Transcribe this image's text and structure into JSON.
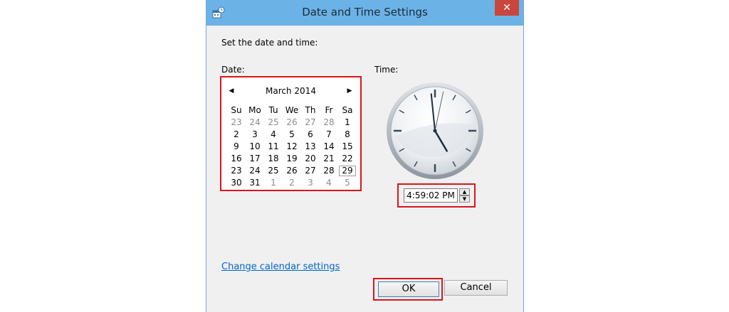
{
  "window": {
    "title": "Date and Time Settings",
    "close_glyph": "✕",
    "accent_color": "#6bb3e6",
    "close_color": "#c9463d",
    "app_icon": "date-time-settings-icon"
  },
  "main": {
    "instruction": "Set the date and time:",
    "date_label": "Date:",
    "time_label": "Time:"
  },
  "calendar": {
    "month_label": "March 2014",
    "prev_glyph": "◀",
    "next_glyph": "▶",
    "days_of_week": [
      "Su",
      "Mo",
      "Tu",
      "We",
      "Th",
      "Fr",
      "Sa"
    ],
    "weeks": [
      [
        {
          "d": "23",
          "o": true
        },
        {
          "d": "24",
          "o": true
        },
        {
          "d": "25",
          "o": true
        },
        {
          "d": "26",
          "o": true
        },
        {
          "d": "27",
          "o": true
        },
        {
          "d": "28",
          "o": true
        },
        {
          "d": "1",
          "o": false
        }
      ],
      [
        {
          "d": "2",
          "o": false
        },
        {
          "d": "3",
          "o": false
        },
        {
          "d": "4",
          "o": false
        },
        {
          "d": "5",
          "o": false
        },
        {
          "d": "6",
          "o": false
        },
        {
          "d": "7",
          "o": false
        },
        {
          "d": "8",
          "o": false
        }
      ],
      [
        {
          "d": "9",
          "o": false
        },
        {
          "d": "10",
          "o": false
        },
        {
          "d": "11",
          "o": false
        },
        {
          "d": "12",
          "o": false
        },
        {
          "d": "13",
          "o": false
        },
        {
          "d": "14",
          "o": false
        },
        {
          "d": "15",
          "o": false
        }
      ],
      [
        {
          "d": "16",
          "o": false
        },
        {
          "d": "17",
          "o": false
        },
        {
          "d": "18",
          "o": false
        },
        {
          "d": "19",
          "o": false
        },
        {
          "d": "20",
          "o": false
        },
        {
          "d": "21",
          "o": false
        },
        {
          "d": "22",
          "o": false
        }
      ],
      [
        {
          "d": "23",
          "o": false
        },
        {
          "d": "24",
          "o": false
        },
        {
          "d": "25",
          "o": false
        },
        {
          "d": "26",
          "o": false
        },
        {
          "d": "27",
          "o": false
        },
        {
          "d": "28",
          "o": false
        },
        {
          "d": "29",
          "o": false,
          "today": true
        }
      ],
      [
        {
          "d": "30",
          "o": false
        },
        {
          "d": "31",
          "o": false
        },
        {
          "d": "1",
          "o": true
        },
        {
          "d": "2",
          "o": true
        },
        {
          "d": "3",
          "o": true
        },
        {
          "d": "4",
          "o": true
        },
        {
          "d": "5",
          "o": true
        }
      ]
    ]
  },
  "clock": {
    "hour": 4,
    "minute": 59,
    "second": 2
  },
  "time_field": {
    "value": "4:59:02 PM",
    "spin_up_glyph": "▲",
    "spin_down_glyph": "▼"
  },
  "footer": {
    "link_label": "Change calendar settings",
    "ok_label": "OK",
    "cancel_label": "Cancel"
  },
  "highlight_color": "#d9151c"
}
